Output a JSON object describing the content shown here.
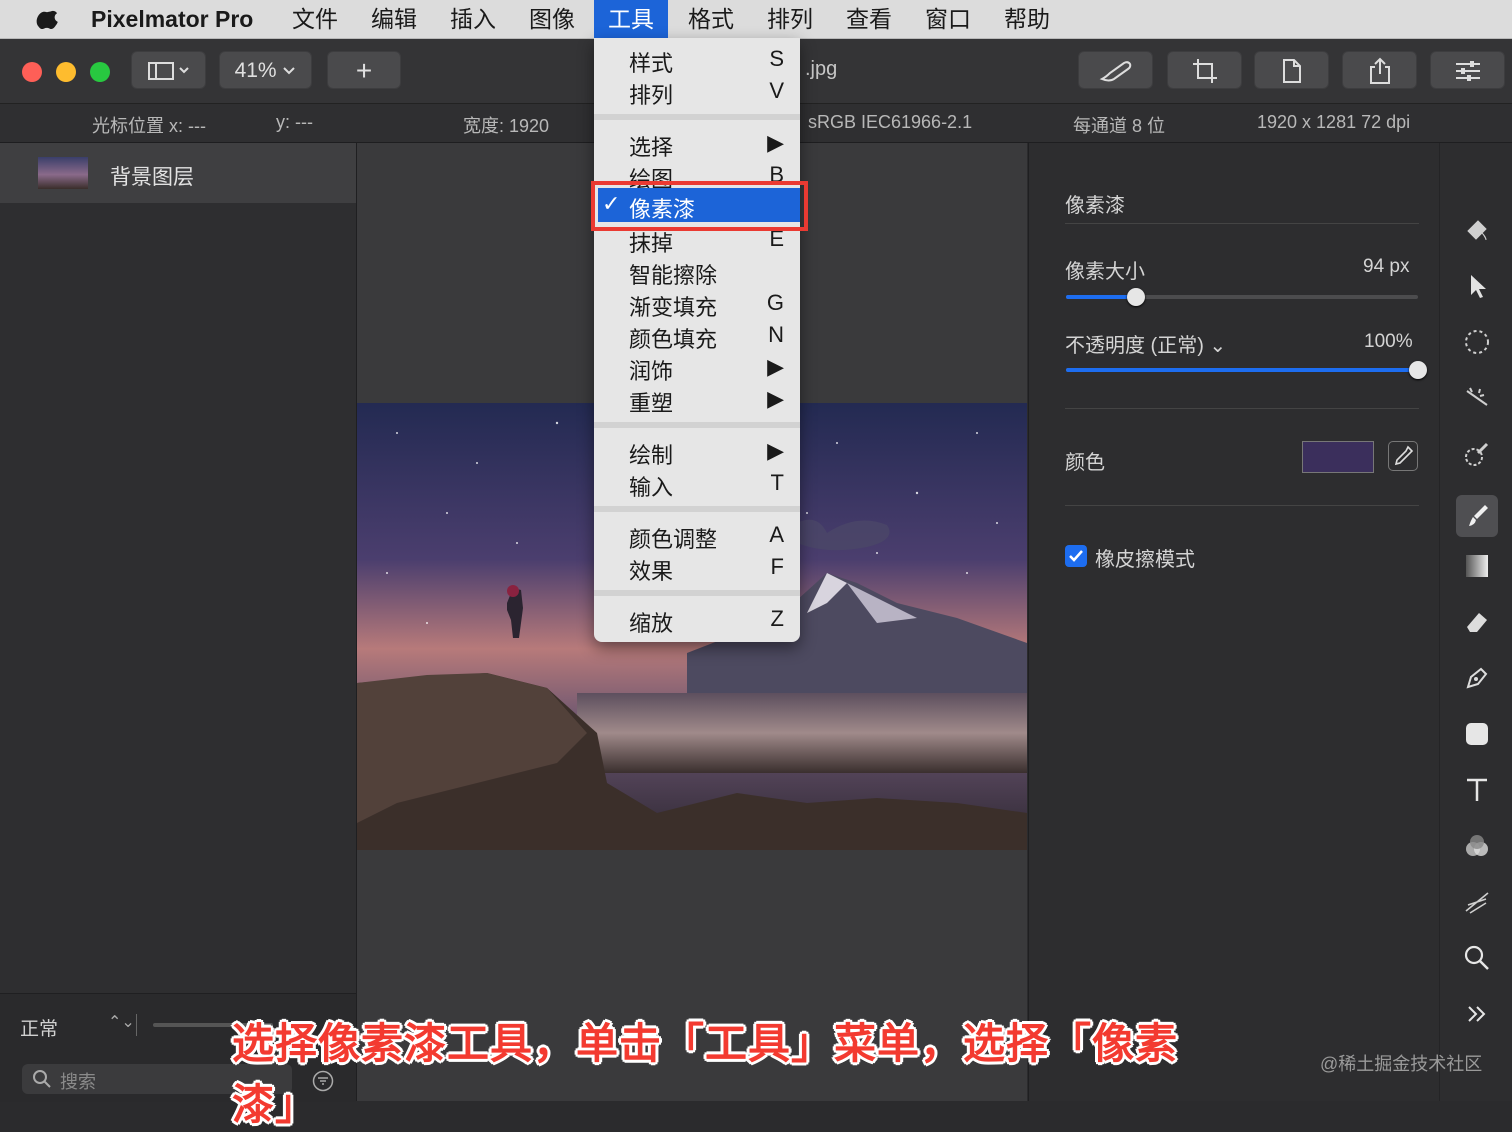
{
  "menubar": {
    "app": "Pixelmator Pro",
    "items": [
      "文件",
      "编辑",
      "插入",
      "图像",
      "工具",
      "格式",
      "排列",
      "查看",
      "窗口",
      "帮助"
    ],
    "active_index": 4
  },
  "toolbar": {
    "zoom": "41%",
    "add": "+",
    "doc_title": ".jpg"
  },
  "infobar": {
    "cursor_x": "光标位置 x:  ---",
    "cursor_y": "y:  ---",
    "width": "宽度: 1920",
    "color_profile": "sRGB IEC61966-2.1",
    "bit_depth": "每通道 8 位",
    "dimensions": "1920 x 1281 72 dpi"
  },
  "layers": {
    "layer_name": "背景图层",
    "blend_mode": "正常",
    "search_placeholder": "搜索"
  },
  "menu": {
    "items": [
      {
        "label": "样式",
        "key": "S"
      },
      {
        "label": "排列",
        "key": "V"
      },
      {
        "label": "选择",
        "key": "▶"
      },
      {
        "label": "绘图",
        "key": "B"
      },
      {
        "label": "像素漆",
        "key": "",
        "checked": true
      },
      {
        "label": "抹掉",
        "key": "E"
      },
      {
        "label": "智能擦除",
        "key": ""
      },
      {
        "label": "渐变填充",
        "key": "G"
      },
      {
        "label": "颜色填充",
        "key": "N"
      },
      {
        "label": "润饰",
        "key": "▶"
      },
      {
        "label": "重塑",
        "key": "▶"
      },
      {
        "label": "绘制",
        "key": "▶"
      },
      {
        "label": "输入",
        "key": "T"
      },
      {
        "label": "颜色调整",
        "key": "A"
      },
      {
        "label": "效果",
        "key": "F"
      },
      {
        "label": "缩放",
        "key": "Z"
      }
    ],
    "check_mark": "✓"
  },
  "inspector": {
    "title": "像素漆",
    "pixel_size_label": "像素大小",
    "pixel_size_value": "94 px",
    "pixel_size_fraction": 0.2,
    "opacity_label": "不透明度 (正常) ⌄",
    "opacity_value": "100%",
    "opacity_fraction": 1.0,
    "color_label": "颜色",
    "color_swatch": "#3b2f5c",
    "eraser_label": "橡皮擦模式",
    "eraser_checked": true
  },
  "caption": "选择像素漆工具，单击「工具」菜单，选择「像素漆」",
  "watermark": "@稀土掘金技术社区",
  "colors": {
    "accent": "#1c64d8",
    "highlight_box": "#ea3a32",
    "caption": "#f33a30"
  }
}
